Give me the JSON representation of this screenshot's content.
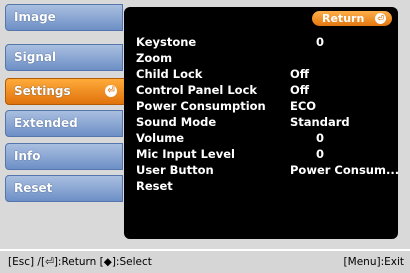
{
  "sidebar": {
    "items": [
      {
        "label": "Image"
      },
      {
        "label": "Signal"
      },
      {
        "label": "Settings",
        "active": true
      },
      {
        "label": "Extended"
      },
      {
        "label": "Info"
      },
      {
        "label": "Reset"
      }
    ],
    "enter_glyph": "⏎"
  },
  "panel": {
    "return_label": "Return",
    "enter_glyph": "⏎",
    "rows": [
      {
        "label": "Keystone",
        "value": "0"
      },
      {
        "label": "Zoom",
        "value": ""
      },
      {
        "label": "Child Lock",
        "value": "Off"
      },
      {
        "label": "Control Panel Lock",
        "value": "Off"
      },
      {
        "label": "Power Consumption",
        "value": "ECO"
      },
      {
        "label": "Sound Mode",
        "value": "Standard"
      },
      {
        "label": "Volume",
        "value": "0"
      },
      {
        "label": "Mic Input Level",
        "value": "0"
      },
      {
        "label": "User Button",
        "value": "Power Consum..."
      },
      {
        "label": "Reset",
        "value": ""
      }
    ]
  },
  "footer": {
    "left": "[Esc] /[⏎]:Return  [◆]:Select",
    "right": "[Menu]:Exit"
  },
  "colors": {
    "accent_orange": "#e0720c",
    "tab_blue": "#6d8fc6",
    "panel_bg": "#000000"
  }
}
